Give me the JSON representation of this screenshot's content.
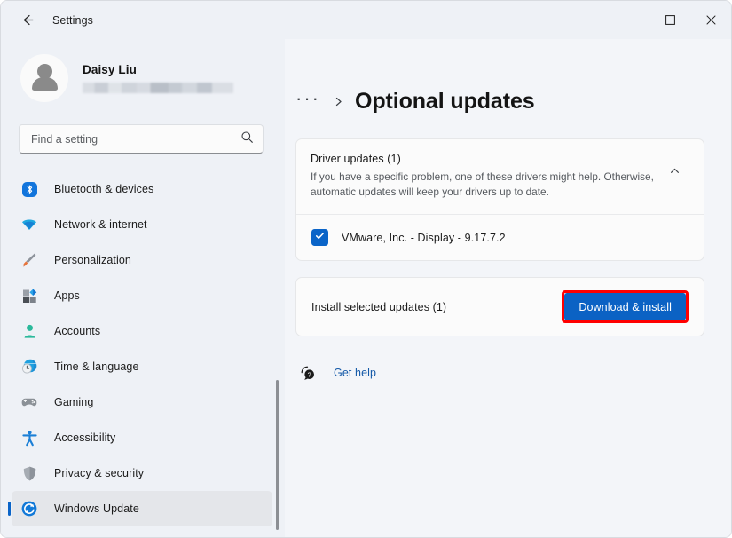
{
  "window": {
    "app_title": "Settings",
    "back_icon": "back-arrow-icon",
    "controls": {
      "minimize": "minimize-icon",
      "maximize": "maximize-icon",
      "close": "close-icon"
    }
  },
  "sidebar": {
    "profile": {
      "name": "Daisy Liu",
      "email_redacted": true,
      "avatar_icon": "user-avatar-icon"
    },
    "search": {
      "placeholder": "Find a setting",
      "value": "",
      "icon": "search-icon"
    },
    "items": [
      {
        "label": "Bluetooth & devices",
        "icon": "bluetooth-icon",
        "selected": false
      },
      {
        "label": "Network & internet",
        "icon": "wifi-icon",
        "selected": false
      },
      {
        "label": "Personalization",
        "icon": "paintbrush-icon",
        "selected": false
      },
      {
        "label": "Apps",
        "icon": "apps-icon",
        "selected": false
      },
      {
        "label": "Accounts",
        "icon": "account-icon",
        "selected": false
      },
      {
        "label": "Time & language",
        "icon": "clock-globe-icon",
        "selected": false
      },
      {
        "label": "Gaming",
        "icon": "gamepad-icon",
        "selected": false
      },
      {
        "label": "Accessibility",
        "icon": "accessibility-icon",
        "selected": false
      },
      {
        "label": "Privacy & security",
        "icon": "shield-icon",
        "selected": false
      },
      {
        "label": "Windows Update",
        "icon": "windows-update-icon",
        "selected": true
      }
    ]
  },
  "main": {
    "breadcrumb": {
      "overflow": "···",
      "separator_icon": "chevron-right-icon",
      "title": "Optional updates"
    },
    "driver_card": {
      "title": "Driver updates (1)",
      "description": "If you have a specific problem, one of these drivers might help. Otherwise, automatic updates will keep your drivers up to date.",
      "expanded": true,
      "collapse_icon": "chevron-up-icon",
      "rows": [
        {
          "label": "VMware, Inc. - Display - 9.17.7.2",
          "checked": true,
          "check_icon": "checkmark-icon"
        }
      ]
    },
    "install_card": {
      "label": "Install selected updates (1)",
      "button_label": "Download & install",
      "highlighted": true
    },
    "get_help": {
      "label": "Get help",
      "icon": "help-question-icon"
    }
  },
  "colors": {
    "accent_blue": "#0b62c4",
    "highlight_red": "#ff0000",
    "link_blue": "#1459a8",
    "sidebar_bg": "#eef1f6",
    "main_bg": "#f3f5f9",
    "card_bg": "#fbfbfb"
  }
}
